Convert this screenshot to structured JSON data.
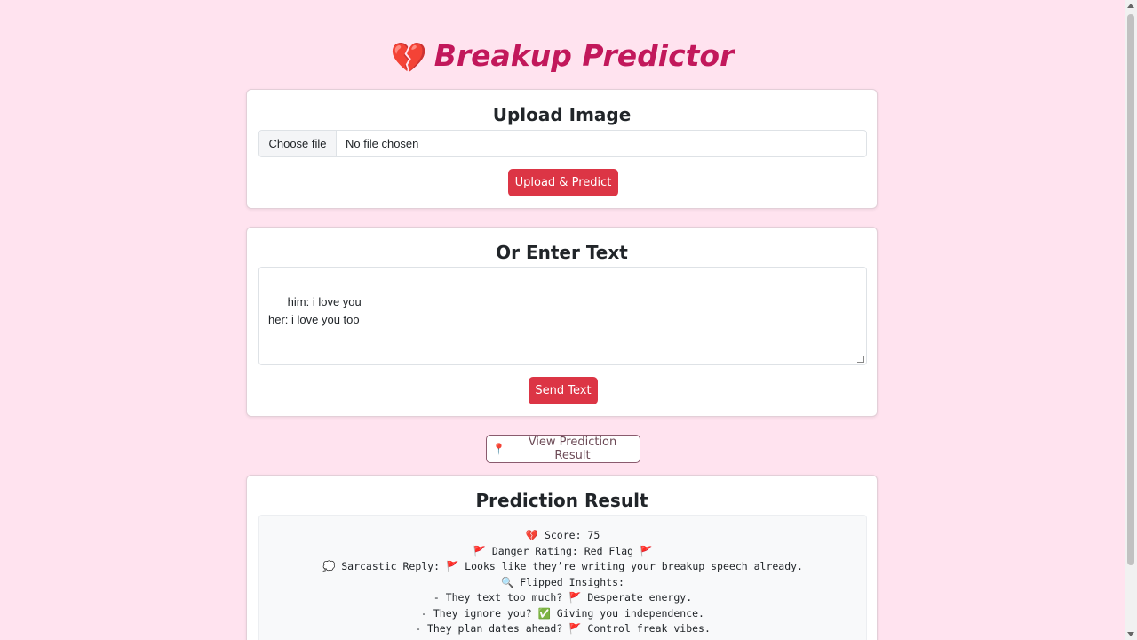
{
  "header": {
    "icon": "broken-heart-icon",
    "icon_glyph": "💔",
    "title": "Breakup Predictor"
  },
  "upload": {
    "heading": "Upload Image",
    "choose_file_label": "Choose file",
    "file_status": "No file chosen",
    "submit_label": "Upload & Predict"
  },
  "text_entry": {
    "heading": "Or Enter Text",
    "value": "him: i love you\nher: i love you too",
    "submit_label": "Send Text"
  },
  "view_result": {
    "icon": "pushpin-icon",
    "icon_glyph": "📍",
    "label": "View Prediction Result"
  },
  "result": {
    "heading": "Prediction Result",
    "lines": [
      "💔 Score: 75",
      "🚩 Danger Rating: Red Flag 🚩",
      "💭 Sarcastic Reply: 🚩 Looks like they’re writing your breakup speech already.",
      "🔍 Flipped Insights:",
      "- They text too much? 🚩 Desperate energy.",
      "- They ignore you? ✅ Giving you independence.",
      "- They plan dates ahead? 🚩 Control freak vibes."
    ]
  },
  "colors": {
    "background": "#ffe3ef",
    "title": "#c2185b",
    "primary_button": "#dc3545"
  }
}
